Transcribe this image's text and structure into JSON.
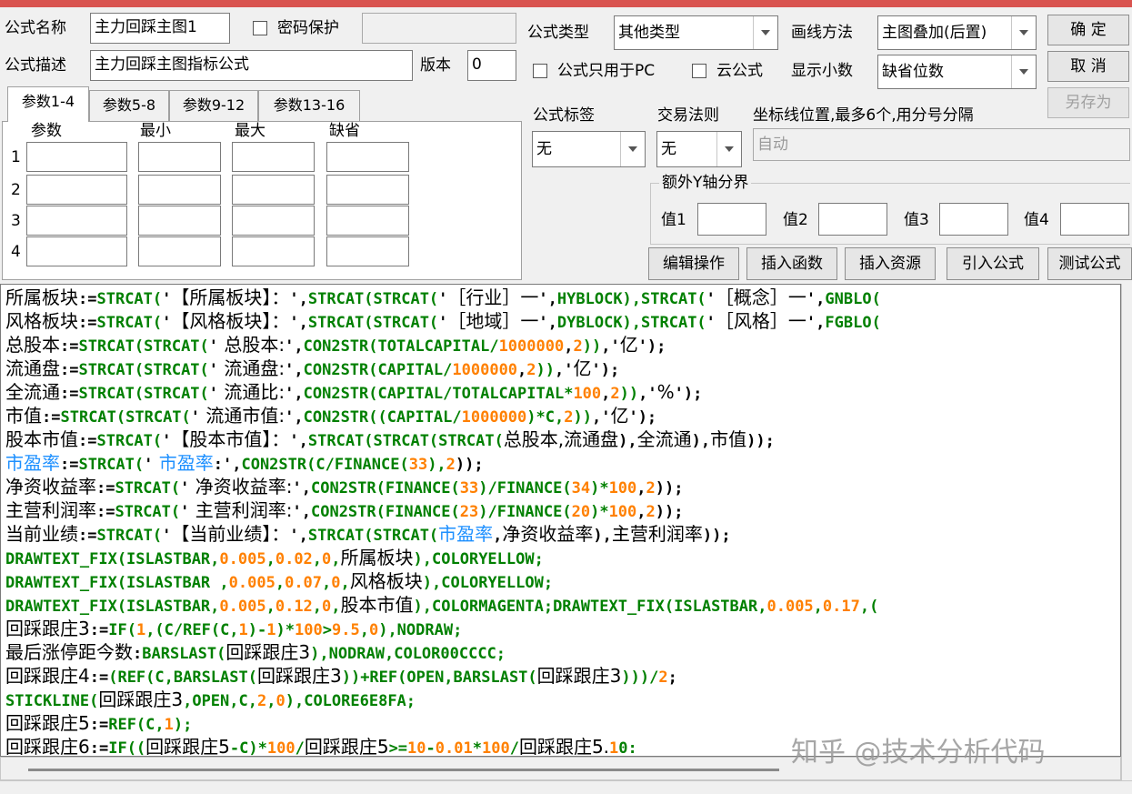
{
  "left_panel": {
    "formula_name_label": "公式名称",
    "formula_name_value": "主力回踩主图1",
    "password_label": "密码保护",
    "formula_desc_label": "公式描述",
    "formula_desc_value": "主力回踩主图指标公式",
    "version_label": "版本",
    "version_value": "0",
    "tabs": [
      "参数1-4",
      "参数5-8",
      "参数9-12",
      "参数13-16"
    ],
    "param_headers": [
      "参数",
      "最小",
      "最大",
      "缺省"
    ],
    "row_numbers": [
      "1",
      "2",
      "3",
      "4"
    ]
  },
  "right_panel": {
    "formula_type_label": "公式类型",
    "formula_type_value": "其他类型",
    "draw_method_label": "画线方法",
    "draw_method_value": "主图叠加(后置)",
    "pc_only_label": "公式只用于PC",
    "cloud_label": "云公式",
    "decimals_label": "显示小数",
    "decimals_value": "缺省位数",
    "tag_label": "公式标签",
    "tag_value": "无",
    "trade_rule_label": "交易法则",
    "trade_rule_value": "无",
    "axis_label": "坐标线位置,最多6个,用分号分隔",
    "axis_value": "自动",
    "extra_y_label": "额外Y轴分界",
    "value_labels": [
      "值1",
      "值2",
      "值3",
      "值4"
    ]
  },
  "buttons": {
    "ok": "确  定",
    "cancel": "取  消",
    "save_as": "另存为",
    "edit_ops": "编辑操作",
    "insert_func": "插入函数",
    "insert_res": "插入资源",
    "import_formula": "引入公式",
    "test_formula": "测试公式"
  },
  "code_lines": [
    [
      [
        "blk",
        "所属板块"
      ],
      [
        "op",
        ":="
      ],
      [
        "grn",
        "STRCAT("
      ],
      [
        "op",
        "'"
      ],
      [
        "blk",
        "【所属板块】："
      ],
      [
        "op",
        "',"
      ],
      [
        "grn",
        "STRCAT(STRCAT("
      ],
      [
        "op",
        "'"
      ],
      [
        "blk",
        "［行业］一"
      ],
      [
        "op",
        "',"
      ],
      [
        "grn",
        "HYBLOCK),STRCAT("
      ],
      [
        "op",
        "'"
      ],
      [
        "blk",
        "［概念］一"
      ],
      [
        "op",
        "',"
      ],
      [
        "grn",
        "GNBLO("
      ]
    ],
    [
      [
        "blk",
        "风格板块"
      ],
      [
        "op",
        ":="
      ],
      [
        "grn",
        "STRCAT("
      ],
      [
        "op",
        "'"
      ],
      [
        "blk",
        "【风格板块】："
      ],
      [
        "op",
        "',"
      ],
      [
        "grn",
        "STRCAT(STRCAT("
      ],
      [
        "op",
        "'"
      ],
      [
        "blk",
        "［地域］一"
      ],
      [
        "op",
        "',"
      ],
      [
        "grn",
        "DYBLOCK),STRCAT("
      ],
      [
        "op",
        "'"
      ],
      [
        "blk",
        "［风格］一"
      ],
      [
        "op",
        "',"
      ],
      [
        "grn",
        "FGBLO("
      ]
    ],
    [
      [
        "blk",
        "总股本"
      ],
      [
        "op",
        ":="
      ],
      [
        "grn",
        "STRCAT(STRCAT("
      ],
      [
        "op",
        "'"
      ],
      [
        "blk",
        " 总股本:"
      ],
      [
        "op",
        "',"
      ],
      [
        "grn",
        "CON2STR(TOTALCAPITAL/"
      ],
      [
        "num",
        "1000000"
      ],
      [
        "op",
        ","
      ],
      [
        "num",
        "2"
      ],
      [
        "grn",
        "))"
      ],
      [
        "op",
        ",'"
      ],
      [
        "blk",
        "亿"
      ],
      [
        "op",
        "');"
      ]
    ],
    [
      [
        "blk",
        "流通盘"
      ],
      [
        "op",
        ":="
      ],
      [
        "grn",
        "STRCAT(STRCAT("
      ],
      [
        "op",
        "'"
      ],
      [
        "blk",
        " 流通盘:"
      ],
      [
        "op",
        "',"
      ],
      [
        "grn",
        "CON2STR(CAPITAL/"
      ],
      [
        "num",
        "1000000"
      ],
      [
        "op",
        ","
      ],
      [
        "num",
        "2"
      ],
      [
        "grn",
        "))"
      ],
      [
        "op",
        ",'"
      ],
      [
        "blk",
        "亿"
      ],
      [
        "op",
        "');"
      ]
    ],
    [
      [
        "blk",
        "全流通"
      ],
      [
        "op",
        ":="
      ],
      [
        "grn",
        "STRCAT(STRCAT("
      ],
      [
        "op",
        "'"
      ],
      [
        "blk",
        " 流通比:"
      ],
      [
        "op",
        "',"
      ],
      [
        "grn",
        "CON2STR(CAPITAL/TOTALCAPITAL*"
      ],
      [
        "num",
        "100"
      ],
      [
        "op",
        ","
      ],
      [
        "num",
        "2"
      ],
      [
        "grn",
        "))"
      ],
      [
        "op",
        ",'"
      ],
      [
        "blk",
        "%"
      ],
      [
        "op",
        "');"
      ]
    ],
    [
      [
        "blk",
        "市值"
      ],
      [
        "op",
        ":="
      ],
      [
        "grn",
        "STRCAT(STRCAT("
      ],
      [
        "op",
        "'"
      ],
      [
        "blk",
        " 流通市值:"
      ],
      [
        "op",
        "',"
      ],
      [
        "grn",
        "CON2STR((CAPITAL/"
      ],
      [
        "num",
        "1000000"
      ],
      [
        "grn",
        ")*C,"
      ],
      [
        "num",
        "2"
      ],
      [
        "grn",
        "))"
      ],
      [
        "op",
        ",'"
      ],
      [
        "blk",
        "亿"
      ],
      [
        "op",
        "');"
      ]
    ],
    [
      [
        "blk",
        "股本市值"
      ],
      [
        "op",
        ":="
      ],
      [
        "grn",
        "STRCAT("
      ],
      [
        "op",
        "'"
      ],
      [
        "blk",
        "【股本市值】："
      ],
      [
        "op",
        "',"
      ],
      [
        "grn",
        "STRCAT(STRCAT(STRCAT("
      ],
      [
        "blk",
        "总股本,流通盘"
      ],
      [
        "op",
        "),"
      ],
      [
        "blk",
        "全流通"
      ],
      [
        "op",
        "),"
      ],
      [
        "blk",
        "市值"
      ],
      [
        "op",
        "));"
      ]
    ],
    [
      [
        "blu",
        "市盈率"
      ],
      [
        "op",
        ":="
      ],
      [
        "grn",
        "STRCAT("
      ],
      [
        "op",
        "'"
      ],
      [
        "blu",
        " 市盈率"
      ],
      [
        "op",
        ":',"
      ],
      [
        "grn",
        "CON2STR(C/FINANCE("
      ],
      [
        "num",
        "33"
      ],
      [
        "grn",
        "),"
      ],
      [
        "num",
        "2"
      ],
      [
        "op",
        "));"
      ]
    ],
    [
      [
        "blk",
        "净资收益率"
      ],
      [
        "op",
        ":="
      ],
      [
        "grn",
        "STRCAT("
      ],
      [
        "op",
        "'"
      ],
      [
        "blk",
        " 净资收益率:"
      ],
      [
        "op",
        "',"
      ],
      [
        "grn",
        "CON2STR(FINANCE("
      ],
      [
        "num",
        "33"
      ],
      [
        "grn",
        ")/FINANCE("
      ],
      [
        "num",
        "34"
      ],
      [
        "grn",
        ")*"
      ],
      [
        "num",
        "100"
      ],
      [
        "op",
        ","
      ],
      [
        "num",
        "2"
      ],
      [
        "op",
        "));"
      ]
    ],
    [
      [
        "blk",
        "主营利润率"
      ],
      [
        "op",
        ":="
      ],
      [
        "grn",
        "STRCAT("
      ],
      [
        "op",
        "'"
      ],
      [
        "blk",
        " 主营利润率:"
      ],
      [
        "op",
        "',"
      ],
      [
        "grn",
        "CON2STR(FINANCE("
      ],
      [
        "num",
        "23"
      ],
      [
        "grn",
        ")/FINANCE("
      ],
      [
        "num",
        "20"
      ],
      [
        "grn",
        ")*"
      ],
      [
        "num",
        "100"
      ],
      [
        "op",
        ","
      ],
      [
        "num",
        "2"
      ],
      [
        "op",
        "));"
      ]
    ],
    [
      [
        "blk",
        "当前业绩"
      ],
      [
        "op",
        ":="
      ],
      [
        "grn",
        "STRCAT("
      ],
      [
        "op",
        "'"
      ],
      [
        "blk",
        "【当前业绩】："
      ],
      [
        "op",
        "',"
      ],
      [
        "grn",
        "STRCAT(STRCAT("
      ],
      [
        "blu",
        "市盈率"
      ],
      [
        "op",
        ","
      ],
      [
        "blk",
        "净资收益率"
      ],
      [
        "op",
        "),"
      ],
      [
        "blk",
        "主营利润率"
      ],
      [
        "op",
        "));"
      ]
    ],
    [
      [
        "grn",
        "DRAWTEXT_FIX(ISLASTBAR,"
      ],
      [
        "num",
        "0.005"
      ],
      [
        "grn",
        ","
      ],
      [
        "num",
        "0.02"
      ],
      [
        "grn",
        ","
      ],
      [
        "num",
        "0"
      ],
      [
        "grn",
        ","
      ],
      [
        "blk",
        "所属板块"
      ],
      [
        "grn",
        "),COLORYELLOW;"
      ]
    ],
    [
      [
        "grn",
        "DRAWTEXT_FIX(ISLASTBAR ,"
      ],
      [
        "num",
        "0.005"
      ],
      [
        "grn",
        ","
      ],
      [
        "num",
        "0.07"
      ],
      [
        "grn",
        ","
      ],
      [
        "num",
        "0"
      ],
      [
        "grn",
        ","
      ],
      [
        "blk",
        "风格板块"
      ],
      [
        "grn",
        "),COLORYELLOW;"
      ]
    ],
    [
      [
        "grn",
        "DRAWTEXT_FIX(ISLASTBAR,"
      ],
      [
        "num",
        "0.005"
      ],
      [
        "grn",
        ","
      ],
      [
        "num",
        "0.12"
      ],
      [
        "grn",
        ","
      ],
      [
        "num",
        "0"
      ],
      [
        "grn",
        ","
      ],
      [
        "blk",
        "股本市值"
      ],
      [
        "grn",
        "),COLORMAGENTA;DRAWTEXT_FIX(ISLASTBAR,"
      ],
      [
        "num",
        "0.005"
      ],
      [
        "grn",
        ","
      ],
      [
        "num",
        "0.17"
      ],
      [
        "grn",
        ",("
      ]
    ],
    [
      [
        "blk",
        "回踩跟庄3"
      ],
      [
        "op",
        ":="
      ],
      [
        "grn",
        "IF("
      ],
      [
        "num",
        "1"
      ],
      [
        "grn",
        ",(C/REF(C,"
      ],
      [
        "num",
        "1"
      ],
      [
        "grn",
        ")-"
      ],
      [
        "num",
        "1"
      ],
      [
        "grn",
        ")*"
      ],
      [
        "num",
        "100"
      ],
      [
        "grn",
        ">"
      ],
      [
        "num",
        "9.5"
      ],
      [
        "grn",
        ","
      ],
      [
        "num",
        "0"
      ],
      [
        "grn",
        "),NODRAW;"
      ]
    ],
    [
      [
        "blk",
        "最后涨停距今数"
      ],
      [
        "op",
        ":"
      ],
      [
        "grn",
        "BARSLAST("
      ],
      [
        "blk",
        "回踩跟庄3"
      ],
      [
        "grn",
        "),NODRAW,COLOR00CCCC;"
      ]
    ],
    [
      [
        "blk",
        "回踩跟庄4"
      ],
      [
        "op",
        ":="
      ],
      [
        "grn",
        "(REF(C,BARSLAST("
      ],
      [
        "blk",
        "回踩跟庄3"
      ],
      [
        "grn",
        "))+REF(OPEN,BARSLAST("
      ],
      [
        "blk",
        "回踩跟庄3"
      ],
      [
        "grn",
        ")))/"
      ],
      [
        "num",
        "2"
      ],
      [
        "op",
        ";"
      ]
    ],
    [
      [
        "grn",
        "STICKLINE("
      ],
      [
        "blk",
        "回踩跟庄3"
      ],
      [
        "grn",
        ",OPEN,C,"
      ],
      [
        "num",
        "2"
      ],
      [
        "grn",
        ","
      ],
      [
        "num",
        "0"
      ],
      [
        "grn",
        "),COLORE6E8FA;"
      ]
    ],
    [
      [
        "blk",
        "回踩跟庄5"
      ],
      [
        "op",
        ":="
      ],
      [
        "grn",
        "REF(C,"
      ],
      [
        "num",
        "1"
      ],
      [
        "grn",
        ");"
      ]
    ],
    [
      [
        "blk",
        "回踩跟庄6"
      ],
      [
        "op",
        ":="
      ],
      [
        "grn",
        "IF(("
      ],
      [
        "blk",
        "回踩跟庄5"
      ],
      [
        "grn",
        "-C)*"
      ],
      [
        "num",
        "100"
      ],
      [
        "grn",
        "/"
      ],
      [
        "blk",
        "回踩跟庄5"
      ],
      [
        "grn",
        ">="
      ],
      [
        "num",
        "10"
      ],
      [
        "grn",
        "-"
      ],
      [
        "num",
        "0.01"
      ],
      [
        "grn",
        "*"
      ],
      [
        "num",
        "100"
      ],
      [
        "grn",
        "/"
      ],
      [
        "blk",
        "回踩跟庄5."
      ],
      [
        "num",
        "1"
      ],
      [
        "grn",
        "0:"
      ]
    ]
  ],
  "watermark": "知乎 @技术分析代码"
}
